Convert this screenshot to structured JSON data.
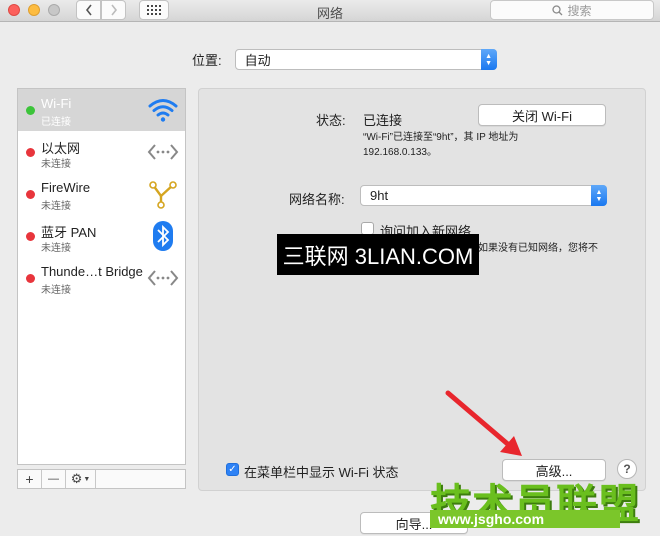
{
  "window": {
    "title": "网络"
  },
  "search": {
    "placeholder": "搜索"
  },
  "location": {
    "label": "位置:",
    "value": "自动"
  },
  "services": [
    {
      "name": "Wi-Fi",
      "status": "已连接",
      "dot": "#3cc43a",
      "icon": "wifi-icon"
    },
    {
      "name": "以太网",
      "status": "未连接",
      "dot": "#e8353c",
      "icon": "ethernet-icon"
    },
    {
      "name": "FireWire",
      "status": "未连接",
      "dot": "#e8353c",
      "icon": "firewire-icon"
    },
    {
      "name": "蓝牙 PAN",
      "status": "未连接",
      "dot": "#e8353c",
      "icon": "bluetooth-icon"
    },
    {
      "name": "Thunde…t Bridge",
      "status": "未连接",
      "dot": "#e8353c",
      "icon": "ethernet-icon"
    }
  ],
  "sidebar_buttons": {
    "add": "+",
    "remove": "—"
  },
  "detail": {
    "status_label": "状态:",
    "status_value": "已连接",
    "toggle_wifi": "关闭 Wi-Fi",
    "status_desc_line1": "“Wi-Fi”已连接至“9ht”，其 IP 地址为",
    "status_desc_line2": "192.168.0.133。",
    "network_name_label": "网络名称:",
    "network_name_value": "9ht",
    "ask_join_label": "询问加入新网络",
    "ask_join_desc": "如果没有已知网络，您将不",
    "show_in_menubar_label": "在菜单栏中显示 Wi-Fi 状态",
    "advanced_button": "高级...",
    "help": "?",
    "assist_button": "向导..."
  },
  "watermarks": {
    "w1": "三联网 3LIAN.COM",
    "w2_top": "技术员联盟",
    "w2_bottom": "www.jsgho.com"
  },
  "colors": {
    "accent": "#1a78f0",
    "selected_bg": "#d6d6d6",
    "wifi_icon": "#1f7cf0"
  }
}
